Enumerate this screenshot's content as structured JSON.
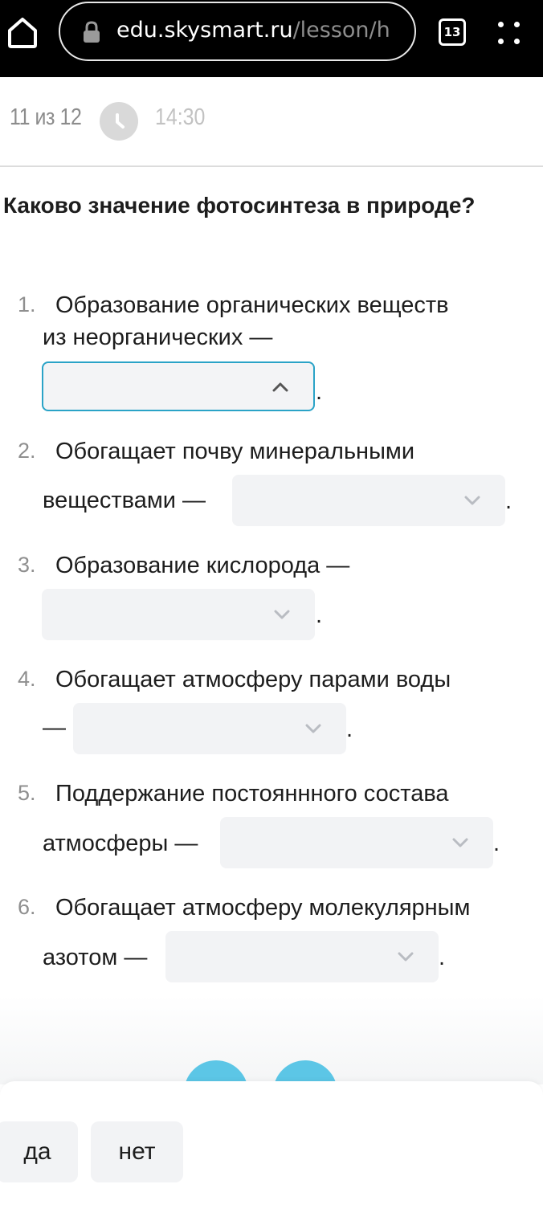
{
  "browser": {
    "url_domain": "edu.skysmart.ru",
    "url_path": "/lesson/h",
    "tab_count": "13"
  },
  "header": {
    "progress": "11 из 12",
    "timer": "14:30"
  },
  "question": {
    "title": "Каково значение фотосинтеза в природе?",
    "items": [
      {
        "number": "1.",
        "lines": [
          "Образование органических веществ",
          "из неорганических —"
        ],
        "selected": "",
        "state": "open"
      },
      {
        "number": "2.",
        "lines": [
          "Обогащает почву минеральными",
          "веществами —"
        ],
        "selected": "",
        "state": "closed"
      },
      {
        "number": "3.",
        "lines": [
          "Образование кислорода —"
        ],
        "selected": "",
        "state": "closed"
      },
      {
        "number": "4.",
        "lines": [
          "Обогащает атмосферу парами воды",
          "—"
        ],
        "selected": "",
        "state": "closed"
      },
      {
        "number": "5.",
        "lines": [
          "Поддержание постояннного состава",
          "атмосферы —"
        ],
        "selected": "",
        "state": "closed"
      },
      {
        "number": "6.",
        "lines": [
          "Обогащает атмосферу молекулярным",
          "азотом —"
        ],
        "selected": "",
        "state": "closed"
      }
    ],
    "terminator": "."
  },
  "options": {
    "yes": "да",
    "no": "нет"
  },
  "colors": {
    "chrome_bg": "#000000",
    "accent": "#2aa3c7",
    "select_bg": "#f2f3f5",
    "bubble": "#5cc6e6"
  }
}
